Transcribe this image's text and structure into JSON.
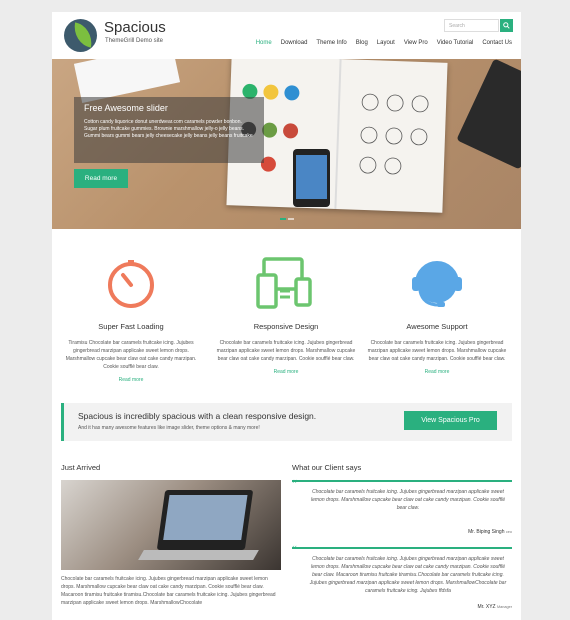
{
  "header": {
    "site_title": "Spacious",
    "site_description": "ThemeGrill Demo site",
    "search_placeholder": "Search",
    "nav": [
      "Home",
      "Download",
      "Theme Info",
      "Blog",
      "Layout",
      "View Pro",
      "Video Tutorial",
      "Contact Us"
    ],
    "active_nav": "Home"
  },
  "slider": {
    "title": "Free Awesome slider",
    "text": "Cotton candy liquorice donut unerdwear.com caramels powder bonbon. Sugar plum fruitcake gummies. Brownie marshmallow jelly-o jelly beans. Gummi bears gummi bears jelly cheesecake jelly beans jelly beans fruitcake",
    "button": "Read more",
    "slides_count": 2,
    "active_slide": 1
  },
  "features": [
    {
      "icon": "speedometer-icon",
      "title": "Super Fast Loading",
      "text": "Tiramisu Chocolate bar caramels fruitcake icing. Jujubes gingerbread marzipan applicake sweet lemon drops. Marshmallow cupcake bear claw oat cake candy marzipan. Cookie soufflé bear claw.",
      "more": "Read more"
    },
    {
      "icon": "devices-icon",
      "title": "Responsive Design",
      "text": "Chocolate bar caramels fruitcake icing. Jujubes gingerbread marzipan applicake sweet lemon drops. Marshmallow cupcake bear claw oat cake candy marzipan. Cookie soufflé bear claw.",
      "more": "Read more"
    },
    {
      "icon": "headset-icon",
      "title": "Awesome Support",
      "text": "Chocolate bar caramels fruitcake icing. Jujubes gingerbread marzipan applicake sweet lemon drops. Marshmallow cupcake bear claw oat cake candy marzipan. Cookie soufflé bear claw.",
      "more": "Read more"
    }
  ],
  "callout": {
    "title": "Spacious is incredibly spacious with a clean responsive design.",
    "subtitle": "And it has many awesome features like image slider, theme options & many more!",
    "button": "View Spacious Pro"
  },
  "just_arrived": {
    "heading": "Just Arrived",
    "text": "Chocolate bar caramels fruitcake icing. Jujubes gingerbread marzipan applicake sweet lemon drops. Marshmallow cupcake bear claw oat cake candy marzipan. Cookie soufflé bear claw. Macaroon tiramisu fruitcake tiramisu.Chocolate bar caramels fruitcake icing. Jujubes gingerbread marzipan applicake sweet lemon drops. MarshmallowChocolate"
  },
  "testimonials": {
    "heading": "What our Client says",
    "items": [
      {
        "text": "Chocolate bar caramels fruitcake icing. Jujubes gingerbread marzipan applicake sweet lemon drops. Marshmallow cupcake bear claw oat cake candy marzipan. Cookie soufflé bear claw.",
        "author": "Mr. Biping Singh",
        "role": "ceo"
      },
      {
        "text": "Chocolate bar caramels fruitcake icing. Jujubes gingerbread marzipan applicake sweet lemon drops. Marshmallow cupcake bear claw oat cake candy marzipan. Cookie soufflé bear claw. Macaroon tiramisu fruitcake tiramisu.Chocolate bar caramels fruitcake icing. Jujubes gingerbread marzipan applicake sweet lemon drops. MarshmallowChocolate bar caramels fruitcake icing. Jujubes ffdsfa",
        "author": "Mr. XYZ",
        "role": "Manager"
      }
    ]
  },
  "colors": {
    "accent": "#2ab07f",
    "icon_orange": "#ef7a5b",
    "icon_green": "#6cc56f",
    "icon_blue": "#5aa7e6"
  }
}
